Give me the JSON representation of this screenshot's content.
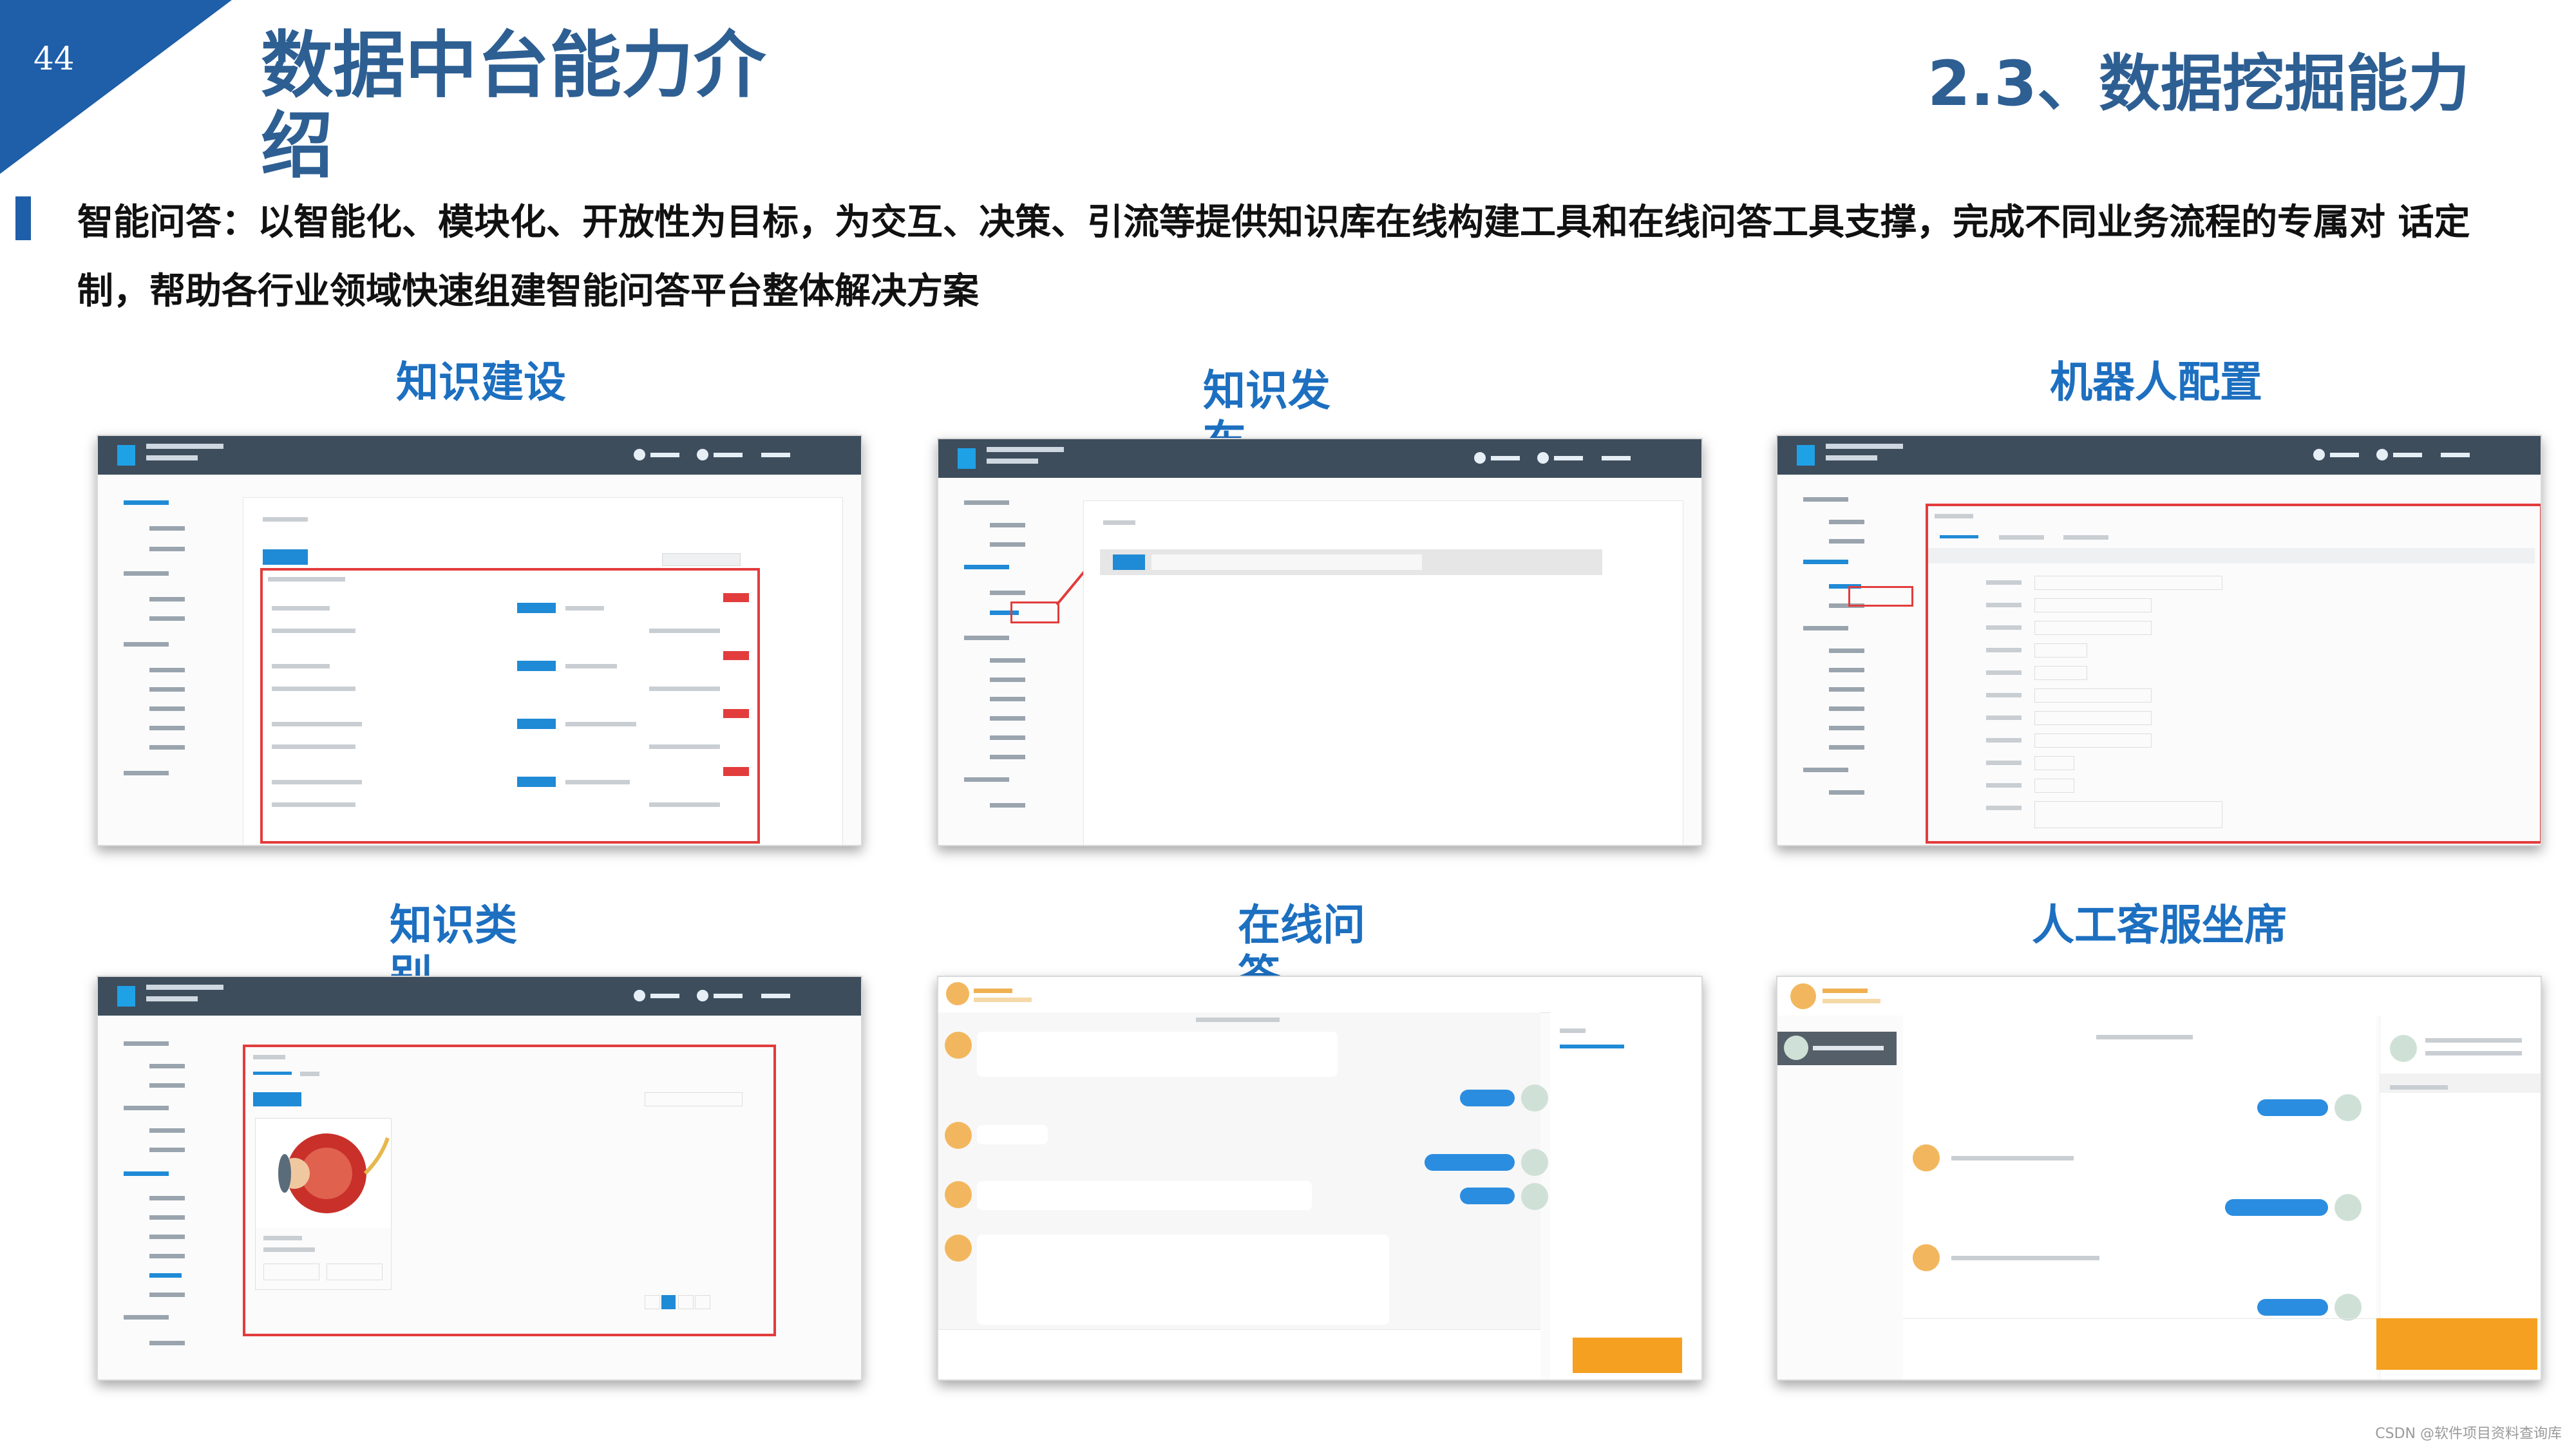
{
  "page": {
    "number": "44",
    "title": "数据中台能力介绍",
    "subtitle": "2.3、数据挖掘能力",
    "description": "智能问答：以智能化、模块化、开放性为目标，为交互、决策、引流等提供知识库在线构建工具和在线问答工具支撑，完成不同业务流程的专属对 话定制，帮助各行业领域快速组建智能问答平台整体解决方案",
    "watermark": "CSDN @软件项目资料查询库"
  },
  "sections": [
    {
      "label": "知识建设"
    },
    {
      "label": "知识发布"
    },
    {
      "label": "机器人配置"
    },
    {
      "label": "知识类别"
    },
    {
      "label": "在线问答"
    },
    {
      "label": "人工客服坐席"
    }
  ],
  "colors": {
    "corner": "#1f5ea8",
    "title": "#2e5f93",
    "section_label": "#1d6fc0",
    "highlight": "#e23c3c",
    "topbar": "#3d4d5c",
    "send_button": "#f5a020"
  }
}
